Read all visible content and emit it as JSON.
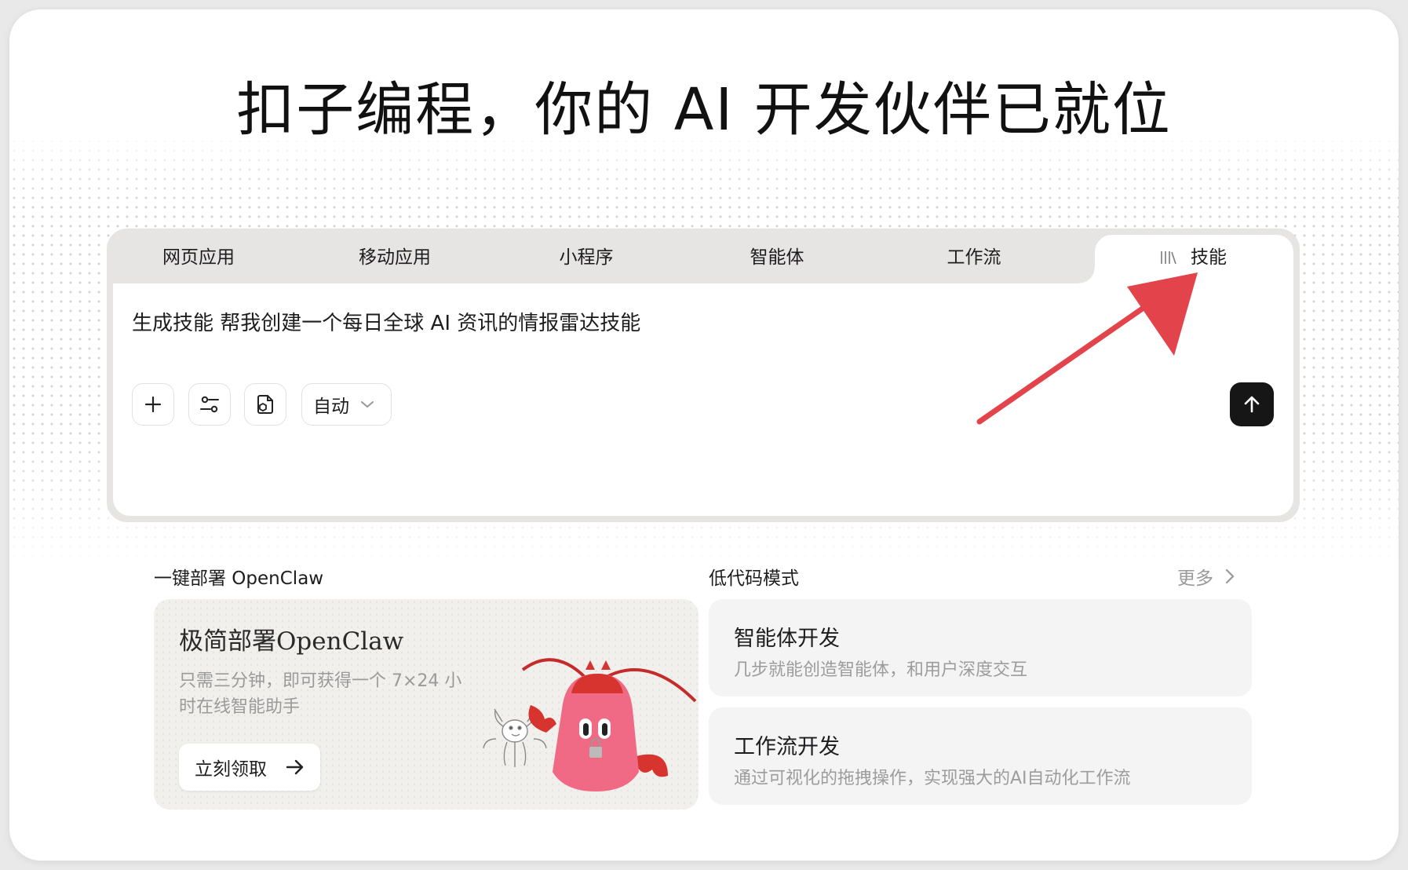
{
  "headline": "扣子编程，你的 AI 开发伙伴已就位",
  "tabs": [
    {
      "label": "网页应用"
    },
    {
      "label": "移动应用"
    },
    {
      "label": "小程序"
    },
    {
      "label": "智能体"
    },
    {
      "label": "工作流"
    },
    {
      "label": "技能",
      "active": true,
      "icon": "library-icon"
    }
  ],
  "composer": {
    "prompt": "生成技能 帮我创建一个每日全球 AI 资讯的情报雷达技能",
    "add_icon": "plus-icon",
    "settings_icon": "sliders-icon",
    "attach_icon": "file-package-icon",
    "mode_label": "自动",
    "send_icon": "arrow-up-icon"
  },
  "openclaw": {
    "section_title": "一键部署 OpenClaw",
    "card_title": "极简部署OpenClaw",
    "card_desc": "只需三分钟，即可获得一个 7×24 小时在线智能助手",
    "button_label": "立刻领取",
    "illustration": "lobster-mascot"
  },
  "lowcode": {
    "section_title": "低代码模式",
    "more_label": "更多",
    "cards": [
      {
        "title": "智能体开发",
        "desc": "几步就能创造智能体，和用户深度交互"
      },
      {
        "title": "工作流开发",
        "desc": "通过可视化的拖拽操作，实现强大的AI自动化工作流"
      }
    ]
  },
  "colors": {
    "annotation_arrow": "#e3434a",
    "tab_bar": "#e6e5e3",
    "send_button": "#161616"
  }
}
